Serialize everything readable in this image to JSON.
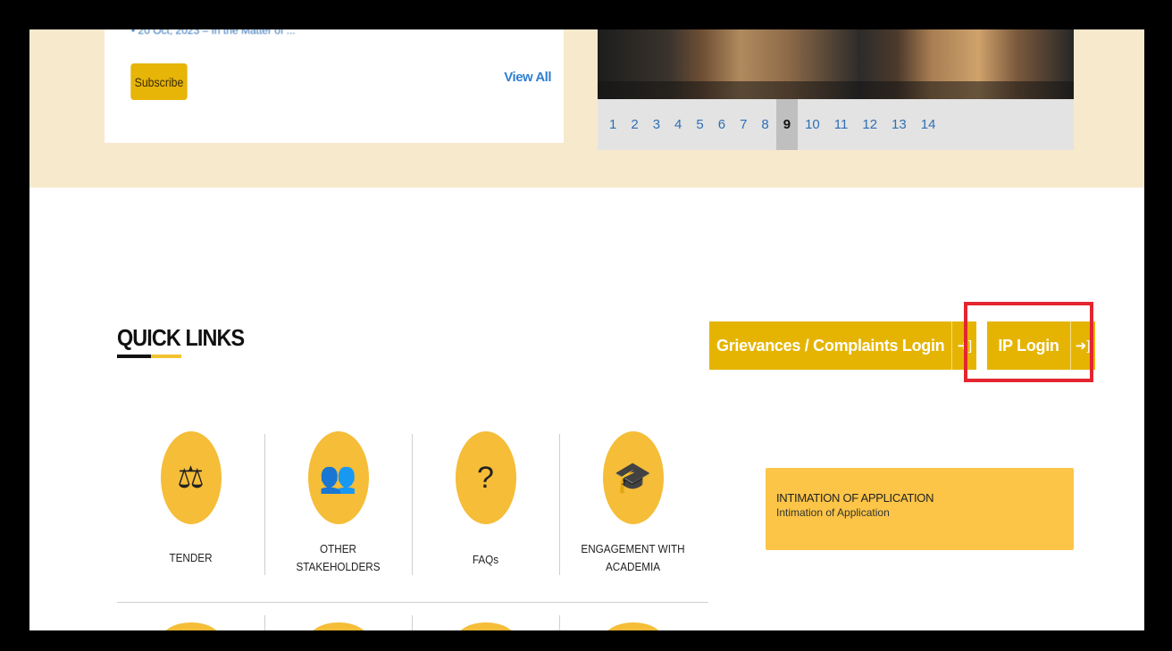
{
  "news": {
    "cut_text": "• 20 Oct, 2023 – In the Matter of ...",
    "subscribe_label": "Subscribe",
    "view_all_label": "View All"
  },
  "slider": {
    "pages": [
      "1",
      "2",
      "3",
      "4",
      "5",
      "6",
      "7",
      "8",
      "9",
      "10",
      "11",
      "12",
      "13",
      "14"
    ],
    "active_page": "9"
  },
  "quick_links": {
    "title": "QUICK LINKS",
    "items": [
      {
        "icon": "gavel-icon",
        "label": "TENDER"
      },
      {
        "icon": "meeting-icon",
        "label_line1": "OTHER",
        "label_line2": "STAKEHOLDERS"
      },
      {
        "icon": "question-bubble-icon",
        "label": "FAQs"
      },
      {
        "icon": "graduation-cap-icon",
        "label_line1": "ENGAGEMENT WITH",
        "label_line2": "ACADEMIA"
      }
    ]
  },
  "login": {
    "grievances_label": "Grievances / Complaints Login",
    "ip_label": "IP Login",
    "icon": "sign-in-icon",
    "highlight_color": "#e3262f",
    "button_color": "#e5b402"
  },
  "intimation": {
    "title": "INTIMATION OF APPLICATION",
    "subtitle": "Intimation of Application"
  },
  "colors": {
    "band": "#f7e9cb",
    "accent": "#f5bd38",
    "link": "#2f7fd1"
  }
}
